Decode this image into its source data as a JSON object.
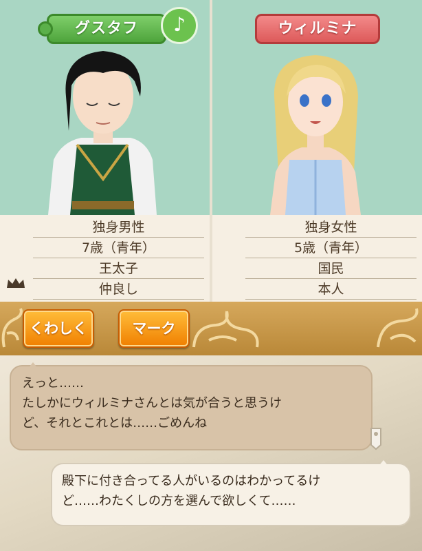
{
  "left_character": {
    "name": "グスタフ",
    "badge_symbol": "♪",
    "info": [
      "独身男性",
      "7歳（青年）",
      "王太子",
      "仲良し"
    ]
  },
  "right_character": {
    "name": "ウィルミナ",
    "info": [
      "独身女性",
      "5歳（青年）",
      "国民",
      "本人"
    ]
  },
  "buttons": {
    "details_label": "くわしく",
    "mark_label": "マーク"
  },
  "dialogue": {
    "left_lines": [
      "えっと……",
      "たしかにウィルミナさんとは気が合うと思うけ",
      "ど、それとこれとは……ごめんね"
    ],
    "right_lines": [
      "殿下に付き合ってる人がいるのはわかってるけ",
      "ど……わたくしの方を選んで欲しくて……"
    ]
  },
  "colors": {
    "portrait_bg": "#a9d6c3",
    "button_orange": "#f07f00",
    "tag_green": "#4ea43c",
    "tag_red": "#dd5a5a"
  }
}
